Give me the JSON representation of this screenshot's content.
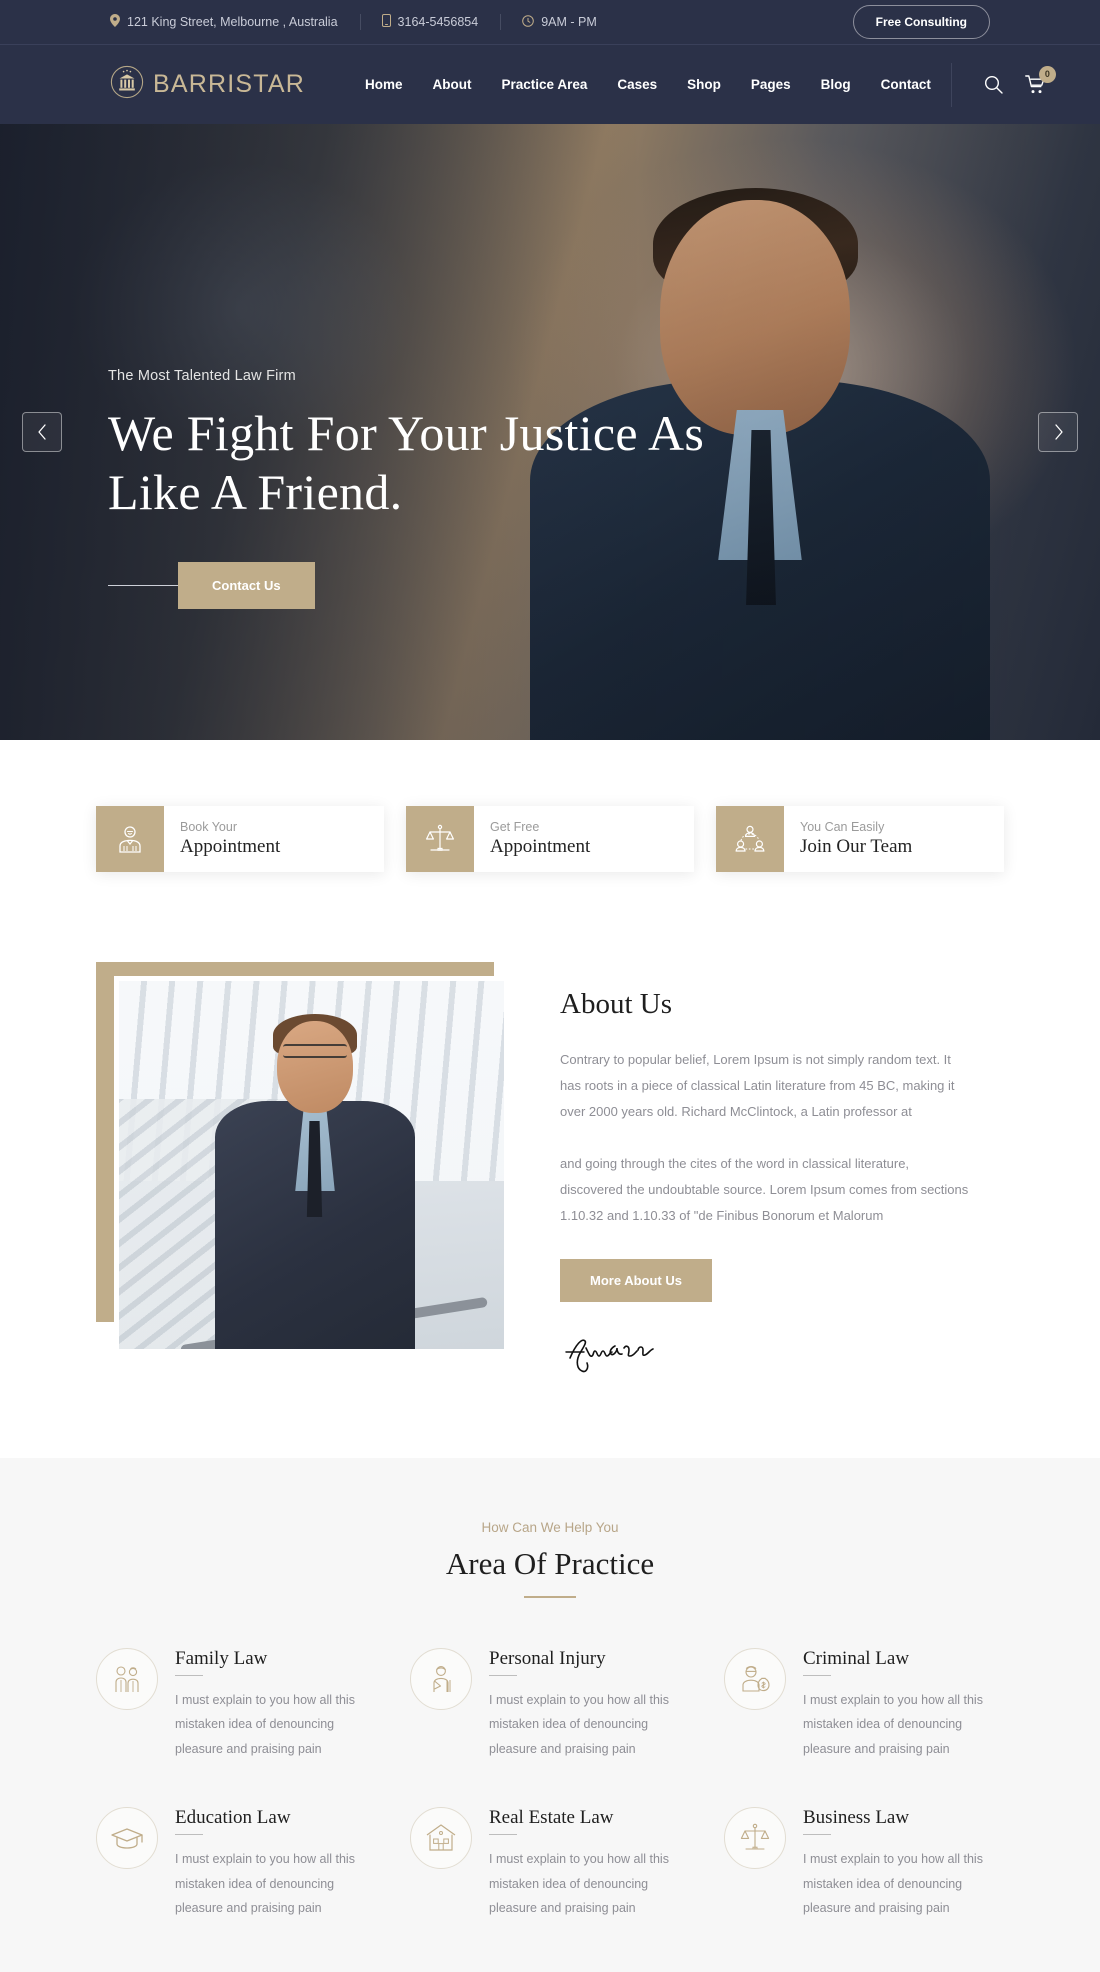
{
  "topbar": {
    "address": "121 King Street, Melbourne , Australia",
    "phone": "3164-5456854",
    "hours": "9AM - PM",
    "consult_label": "Free Consulting"
  },
  "nav": {
    "logo_text": "BARRISTAR",
    "links": [
      {
        "label": "Home"
      },
      {
        "label": "About"
      },
      {
        "label": "Practice Area"
      },
      {
        "label": "Cases"
      },
      {
        "label": "Shop"
      },
      {
        "label": "Pages"
      },
      {
        "label": "Blog"
      },
      {
        "label": "Contact"
      }
    ],
    "cart_count": "0"
  },
  "hero": {
    "eyebrow": "The Most Talented Law Firm",
    "title_line1": "We Fight For Your Justice As",
    "title_line2": "Like A Friend.",
    "cta_label": "Contact Us",
    "prev_label": "‹",
    "next_label": "›"
  },
  "features": [
    {
      "sub": "Book Your",
      "title": "Appointment",
      "icon": "person-tie-icon"
    },
    {
      "sub": "Get Free",
      "title": "Appointment",
      "icon": "scales-icon"
    },
    {
      "sub": "You Can Easily",
      "title": "Join Our Team",
      "icon": "team-icon"
    }
  ],
  "about": {
    "title": "About Us",
    "p1": "Contrary to popular belief, Lorem Ipsum is not simply random text. It has roots in a piece of classical Latin literature from 45 BC, making it over 2000 years old. Richard McClintock, a Latin professor at",
    "p2": "and going through the cites of the word in classical literature, discovered the undoubtable source. Lorem Ipsum comes from sections 1.10.32 and 1.10.33 of \"de Finibus Bonorum et Malorum",
    "button_label": "More About Us",
    "signature_text": "Signature"
  },
  "practice": {
    "eyebrow": "How Can We Help You",
    "title": "Area Of Practice",
    "cards": [
      {
        "name": "Family Law",
        "desc": "I must explain to you how all this mistaken idea of denouncing pleasure and praising pain",
        "icon": "family-couple-icon"
      },
      {
        "name": "Personal Injury",
        "desc": "I must explain to you how all this mistaken idea of denouncing pleasure and praising pain",
        "icon": "injured-person-icon"
      },
      {
        "name": "Criminal Law",
        "desc": "I must explain to you how all this mistaken idea of denouncing pleasure and praising pain",
        "icon": "burglar-moneybag-icon"
      },
      {
        "name": "Education Law",
        "desc": "I must explain to you how all this mistaken idea of denouncing pleasure and praising pain",
        "icon": "graduation-cap-icon"
      },
      {
        "name": "Real Estate Law",
        "desc": "I must explain to you how all this mistaken idea of denouncing pleasure and praising pain",
        "icon": "house-icon"
      },
      {
        "name": "Business Law",
        "desc": "I must explain to you how all this mistaken idea of denouncing pleasure and praising pain",
        "icon": "scales-icon"
      }
    ]
  },
  "colors": {
    "navy": "#2b3148",
    "gold": "#c0ad8a",
    "gold_text": "#c9b896",
    "muted": "#8e8e95",
    "section_bg": "#f7f7f7"
  }
}
